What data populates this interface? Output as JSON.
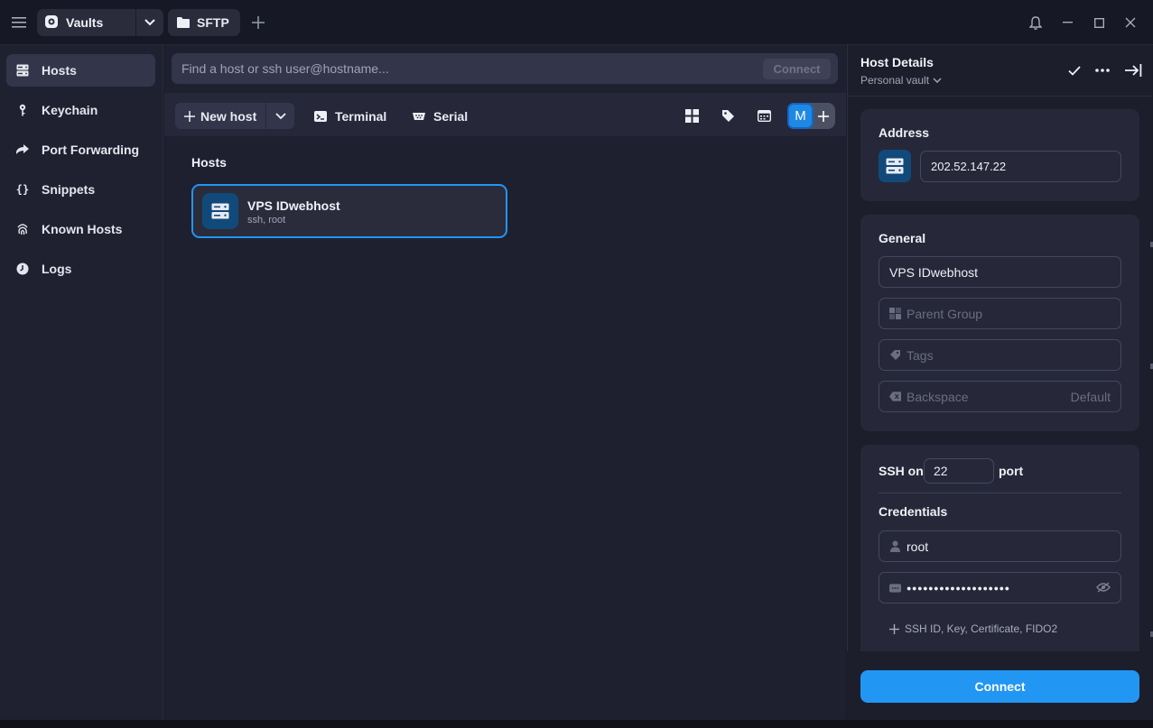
{
  "titlebar": {
    "vaults_label": "Vaults",
    "sftp_label": "SFTP"
  },
  "sidebar": {
    "items": [
      {
        "label": "Hosts",
        "icon": "hosts-icon",
        "active": true
      },
      {
        "label": "Keychain",
        "icon": "key-icon"
      },
      {
        "label": "Port Forwarding",
        "icon": "forward-icon"
      },
      {
        "label": "Snippets",
        "icon": "braces-icon"
      },
      {
        "label": "Known Hosts",
        "icon": "fingerprint-icon"
      },
      {
        "label": "Logs",
        "icon": "clock-icon"
      }
    ]
  },
  "search": {
    "placeholder": "Find a host or ssh user@hostname...",
    "connect_label": "Connect"
  },
  "toolbar": {
    "new_host_label": "New host",
    "terminal_label": "Terminal",
    "serial_label": "Serial",
    "avatar_initial": "M"
  },
  "hosts": {
    "section_title": "Hosts",
    "items": [
      {
        "name": "VPS IDwebhost",
        "sub": "ssh, root"
      }
    ]
  },
  "panel": {
    "title": "Host Details",
    "vault": "Personal vault",
    "address": {
      "title": "Address",
      "value": "202.52.147.22"
    },
    "general": {
      "title": "General",
      "label_value": "VPS IDwebhost",
      "parent_group_placeholder": "Parent Group",
      "tags_placeholder": "Tags",
      "backspace_label": "Backspace",
      "backspace_value": "Default"
    },
    "ssh": {
      "ssh_on_label": "SSH on",
      "port": "22",
      "port_label": "port",
      "credentials_title": "Credentials",
      "username": "root",
      "password_mask": "●●●●●●●●●●●●●●●●●●●",
      "add_key_label": "SSH ID, Key, Certificate, FIDO2"
    },
    "connect_label": "Connect"
  },
  "colors": {
    "accent": "#2196f3",
    "background": "#1e2030",
    "sidebar": "#1f2130",
    "card": "#262839"
  }
}
